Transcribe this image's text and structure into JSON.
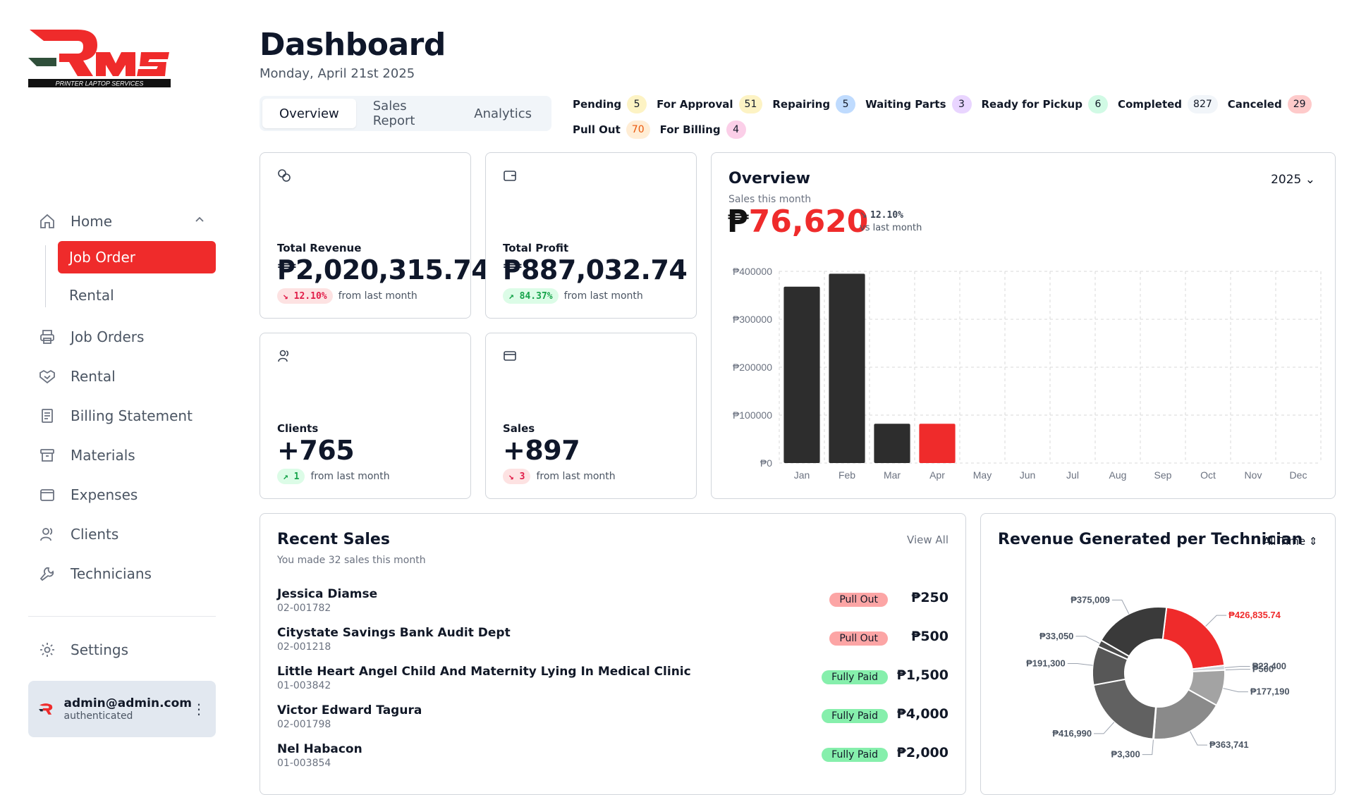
{
  "brand": {
    "logo_text": "PRINTER LAPTOP SERVICES",
    "logo_colors": {
      "red": "#ef2b2b",
      "dark": "#1f2937"
    }
  },
  "sidebar": {
    "home_label": "Home",
    "sub_items": [
      {
        "label": "Job Order",
        "active": true
      },
      {
        "label": "Rental",
        "active": false
      }
    ],
    "items": [
      {
        "label": "Job Orders",
        "icon": "printer-icon"
      },
      {
        "label": "Rental",
        "icon": "handshake-icon"
      },
      {
        "label": "Billing Statement",
        "icon": "receipt-icon"
      },
      {
        "label": "Materials",
        "icon": "archive-icon"
      },
      {
        "label": "Expenses",
        "icon": "wallet-icon"
      },
      {
        "label": "Clients",
        "icon": "users-icon"
      },
      {
        "label": "Technicians",
        "icon": "wrench-icon"
      }
    ],
    "settings_label": "Settings",
    "user": {
      "email": "admin@admin.com",
      "status": "authenticated"
    }
  },
  "header": {
    "title": "Dashboard",
    "date": "Monday, April 21st 2025",
    "tabs": [
      {
        "label": "Overview",
        "active": true
      },
      {
        "label": "Sales Report",
        "active": false
      },
      {
        "label": "Analytics",
        "active": false
      }
    ]
  },
  "statuses": [
    {
      "label": "Pending",
      "count": "5",
      "color": "#fdf3c4"
    },
    {
      "label": "For Approval",
      "count": "51",
      "color": "#fdf3c4"
    },
    {
      "label": "Repairing",
      "count": "5",
      "color": "#bfdbfe"
    },
    {
      "label": "Waiting Parts",
      "count": "3",
      "color": "#e9d5ff"
    },
    {
      "label": "Ready for Pickup",
      "count": "6",
      "color": "#d1fae5"
    },
    {
      "label": "Completed",
      "count": "827",
      "color": "#f1f5f9"
    },
    {
      "label": "Canceled",
      "count": "29",
      "color": "#fecaca"
    },
    {
      "label": "Pull Out",
      "count": "70",
      "color": "#ffedd5"
    },
    {
      "label": "For Billing",
      "count": "4",
      "color": "#fbcfe8"
    }
  ],
  "stats": {
    "revenue": {
      "label": "Total Revenue",
      "value": "₱2,020,315.74",
      "delta": "12.10%",
      "trend": "down",
      "note": "from last month"
    },
    "profit": {
      "label": "Total Profit",
      "value": "₱887,032.74",
      "delta": "84.37%",
      "trend": "up",
      "note": "from last month"
    },
    "clients": {
      "label": "Clients",
      "value": "+765",
      "delta": "1",
      "trend": "up",
      "note": "from last month"
    },
    "sales": {
      "label": "Sales",
      "value": "+897",
      "delta": "3",
      "trend": "down",
      "note": "from last month"
    }
  },
  "overview": {
    "title": "Overview",
    "subtitle": "Sales this month",
    "currency": "₱",
    "amount": "76,620",
    "delta": "12.10%",
    "delta_note": "vs last month",
    "year": "2025"
  },
  "chart_data": {
    "type": "bar",
    "categories": [
      "Jan",
      "Feb",
      "Mar",
      "Apr",
      "May",
      "Jun",
      "Jul",
      "Aug",
      "Sep",
      "Oct",
      "Nov",
      "Dec"
    ],
    "values": [
      368000,
      395000,
      82000,
      82000,
      0,
      0,
      0,
      0,
      0,
      0,
      0,
      0
    ],
    "highlight_index": 3,
    "yticks": [
      "₱0",
      "₱100000",
      "₱200000",
      "₱300000",
      "₱400000"
    ],
    "ylim": [
      0,
      400000
    ],
    "grid": true,
    "colors": {
      "bar": "#2d2d2d",
      "highlight": "#ef2b2b"
    }
  },
  "recent_sales": {
    "title": "Recent Sales",
    "subtitle": "You made 32 sales this month",
    "view_all": "View All",
    "rows": [
      {
        "name": "Jessica Diamse",
        "id": "02-001782",
        "status": "Pull Out",
        "amount": "₱250"
      },
      {
        "name": "Citystate Savings Bank Audit Dept",
        "id": "02-001218",
        "status": "Pull Out",
        "amount": "₱500"
      },
      {
        "name": "Little Heart Angel Child And Maternity Lying In Medical Clinic",
        "id": "01-003842",
        "status": "Fully Paid",
        "amount": "₱1,500"
      },
      {
        "name": "Victor Edward Tagura",
        "id": "02-001798",
        "status": "Fully Paid",
        "amount": "₱4,000"
      },
      {
        "name": "Nel Habacon",
        "id": "01-003854",
        "status": "Fully Paid",
        "amount": "₱2,000"
      }
    ]
  },
  "technicians": {
    "title": "Revenue Generated per Technician",
    "range": "All Time",
    "slices": [
      {
        "value": 426835.74,
        "label": "₱426,835.74",
        "color": "#ef2b2b"
      },
      {
        "value": 22400,
        "label": "₱22,400",
        "color": "#d1d5db"
      },
      {
        "value": 500,
        "label": "₱500",
        "color": "#9ca3af"
      },
      {
        "value": 177190,
        "label": "₱177,190",
        "color": "#a3a3a3"
      },
      {
        "value": 363741,
        "label": "₱363,741",
        "color": "#8a8a8a"
      },
      {
        "value": 3300,
        "label": "₱3,300",
        "color": "#6b6b6b"
      },
      {
        "value": 416990,
        "label": "₱416,990",
        "color": "#616161"
      },
      {
        "value": 191300,
        "label": "₱191,300",
        "color": "#575757"
      },
      {
        "value": 33050,
        "label": "₱33,050",
        "color": "#4b4b4b"
      },
      {
        "value": 375009,
        "label": "₱375,009",
        "color": "#3a3a3a"
      }
    ]
  }
}
